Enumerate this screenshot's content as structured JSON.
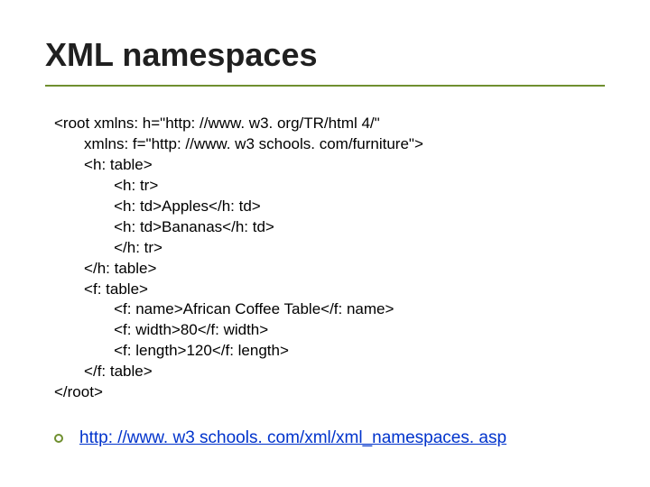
{
  "title": "XML namespaces",
  "code": {
    "lines": [
      "<root xmlns: h=\"http: //www. w3. org/TR/html 4/\"",
      "       xmlns: f=\"http: //www. w3 schools. com/furniture\">",
      "       <h: table>",
      "              <h: tr>",
      "              <h: td>Apples</h: td>",
      "              <h: td>Bananas</h: td>",
      "              </h: tr>",
      "       </h: table>",
      "       <f: table>",
      "              <f: name>African Coffee Table</f: name>",
      "              <f: width>80</f: width>",
      "              <f: length>120</f: length>",
      "       </f: table>",
      "</root>"
    ]
  },
  "link": {
    "url_text": "http: //www. w3 schools. com/xml/xml_namespaces. asp"
  }
}
